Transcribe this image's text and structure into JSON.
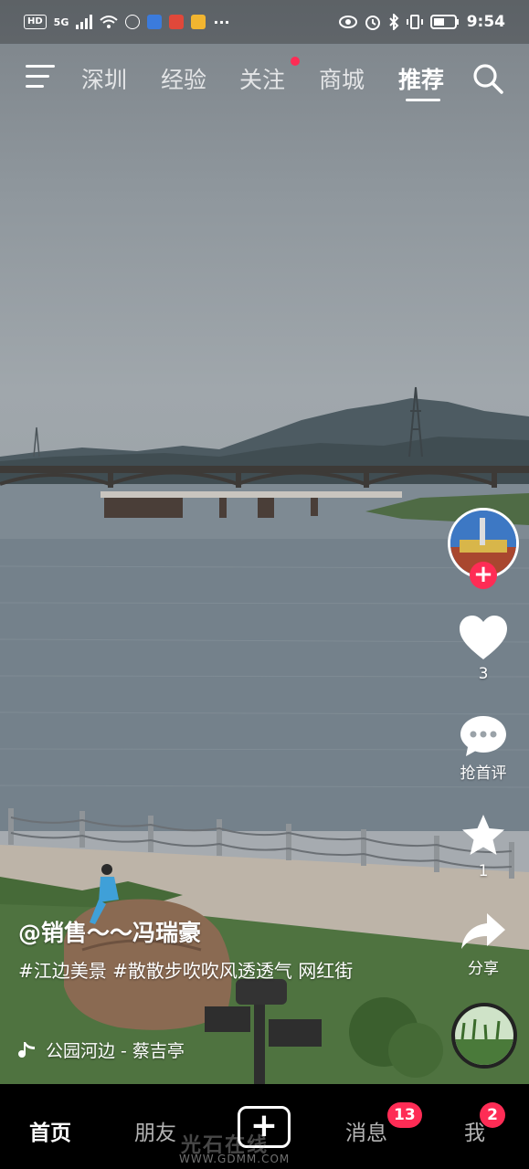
{
  "status_bar": {
    "left_chips": [
      "HD",
      "5G"
    ],
    "time": "9:54",
    "app_icons": [
      "wifi-icon",
      "signal-icon",
      "jdm-icon",
      "jdm-blue-icon",
      "red-app-icon",
      "weibo-icon",
      "more-dots-icon"
    ],
    "right_icons": [
      "eye-icon",
      "alarm-icon",
      "bluetooth-icon",
      "vibrate-icon",
      "battery-icon"
    ]
  },
  "top_nav": {
    "tabs": [
      "深圳",
      "经验",
      "关注",
      "商城",
      "推荐"
    ],
    "active_tab": "推荐",
    "dot_on": "关注"
  },
  "right_rail": {
    "likes": "3",
    "comments_label": "抢首评",
    "favorites": "1",
    "share_label": "分享",
    "follow_plus": "+"
  },
  "caption": {
    "author": "@销售～～冯瑞豪",
    "description": "#江边美景 #散散步吹吹风透透气 网红街",
    "music": "公园河边 - 蔡吉亭"
  },
  "bottom_bar": {
    "home": "首页",
    "friends": "朋友",
    "plus": "+",
    "messages": "消息",
    "messages_badge": "13",
    "me": "我",
    "me_badge": "2"
  },
  "watermark": {
    "brand": "光石在线",
    "url": "WWW.GDMM.COM"
  },
  "colors": {
    "accent": "#fe2c55",
    "sky": "#9aa1a7",
    "water": "#6f7d88",
    "grass": "#4c6f3a"
  }
}
